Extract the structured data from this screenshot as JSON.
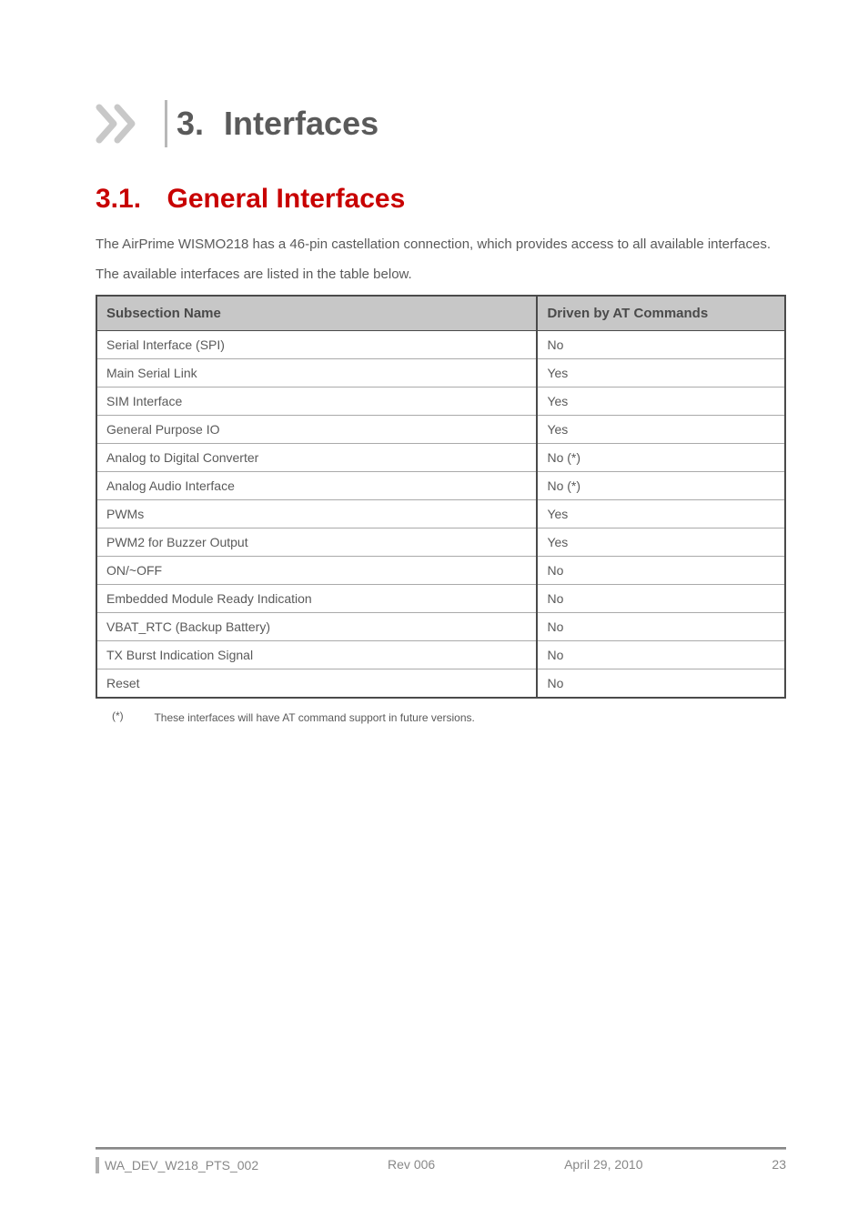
{
  "chapter": {
    "number": "3.",
    "title": "Interfaces"
  },
  "section": {
    "number": "3.1.",
    "title": "General Interfaces"
  },
  "paragraphs": {
    "p1": "The AirPrime WISMO218 has a 46-pin castellation connection, which provides access to all available interfaces.",
    "p2": "The available interfaces are listed in the table below."
  },
  "table": {
    "headers": {
      "name": "Subsection Name",
      "cmds": "Driven by AT Commands"
    },
    "rows": [
      {
        "name": "Serial Interface (SPI)",
        "cmds": "No"
      },
      {
        "name": "Main Serial Link",
        "cmds": "Yes"
      },
      {
        "name": "SIM Interface",
        "cmds": "Yes"
      },
      {
        "name": "General Purpose IO",
        "cmds": "Yes"
      },
      {
        "name": "Analog to Digital Converter",
        "cmds": "No (*)"
      },
      {
        "name": "Analog Audio Interface",
        "cmds": "No (*)"
      },
      {
        "name": "PWMs",
        "cmds": "Yes"
      },
      {
        "name": "PWM2 for Buzzer Output",
        "cmds": "Yes"
      },
      {
        "name": "ON/~OFF",
        "cmds": "No"
      },
      {
        "name": "Embedded Module Ready Indication",
        "cmds": "No"
      },
      {
        "name": "VBAT_RTC (Backup Battery)",
        "cmds": "No"
      },
      {
        "name": "TX Burst Indication Signal",
        "cmds": "No"
      },
      {
        "name": "Reset",
        "cmds": "No"
      }
    ]
  },
  "footnote": {
    "mark": "(*)",
    "text": "These interfaces will have AT command support in future versions."
  },
  "footer": {
    "doc_id": "WA_DEV_W218_PTS_002",
    "rev": "Rev 006",
    "date": "April 29, 2010",
    "page": "23"
  }
}
